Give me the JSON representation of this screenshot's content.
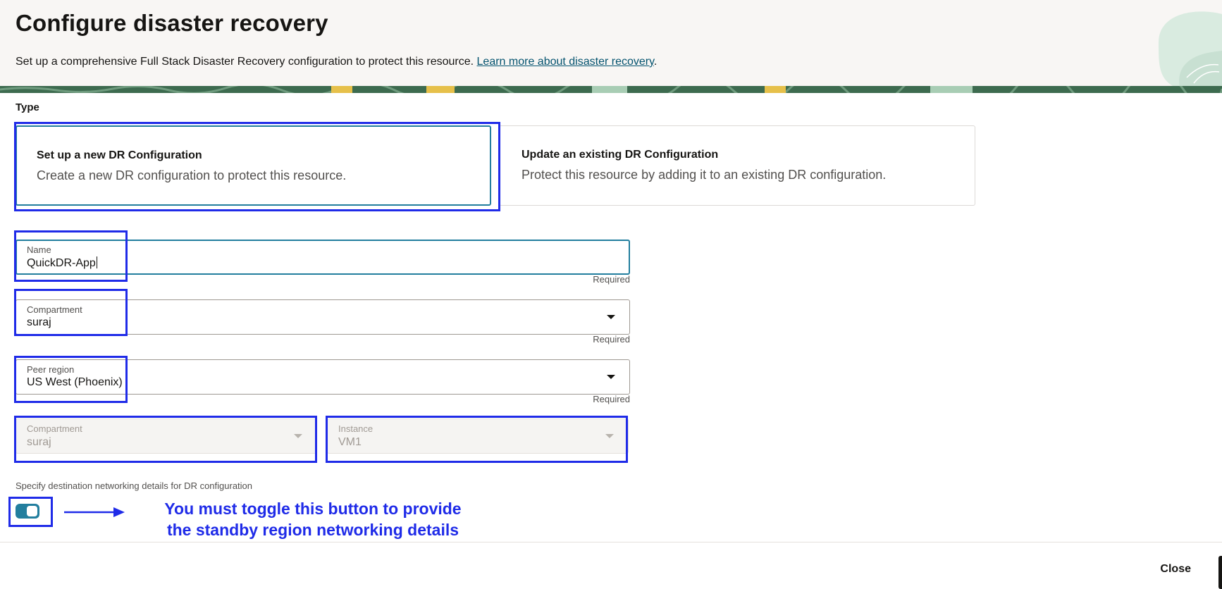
{
  "header": {
    "title": "Configure disaster recovery",
    "description": "Set up a comprehensive Full Stack Disaster Recovery configuration to protect this resource.",
    "learn_more_link": "Learn more about disaster recovery",
    "description_end": "."
  },
  "type_section": {
    "label": "Type",
    "options": [
      {
        "title": "Set up a new DR Configuration",
        "description": "Create a new DR configuration to protect this resource.",
        "selected": true
      },
      {
        "title": "Update an existing DR Configuration",
        "description": "Protect this resource by adding it to an existing DR configuration.",
        "selected": false
      }
    ]
  },
  "form": {
    "name": {
      "label": "Name",
      "value": "QuickDR-App",
      "required_text": "Required"
    },
    "compartment": {
      "label": "Compartment",
      "value": "suraj",
      "required_text": "Required"
    },
    "peer_region": {
      "label": "Peer region",
      "value": "US West (Phoenix)",
      "required_text": "Required"
    },
    "disabled_compartment": {
      "label": "Compartment",
      "value": "suraj"
    },
    "instance": {
      "label": "Instance",
      "value": "VM1"
    }
  },
  "networking": {
    "label": "Specify destination networking details for DR configuration",
    "toggle_on": true
  },
  "annotation": {
    "line1": "You must toggle this button to provide",
    "line2": "the standby region networking details",
    "color": "#1f2be8"
  },
  "footer": {
    "close_label": "Close"
  },
  "colors": {
    "accent": "#227e9e",
    "annotation": "#1f2be8",
    "header_bg": "#f8f6f4"
  }
}
